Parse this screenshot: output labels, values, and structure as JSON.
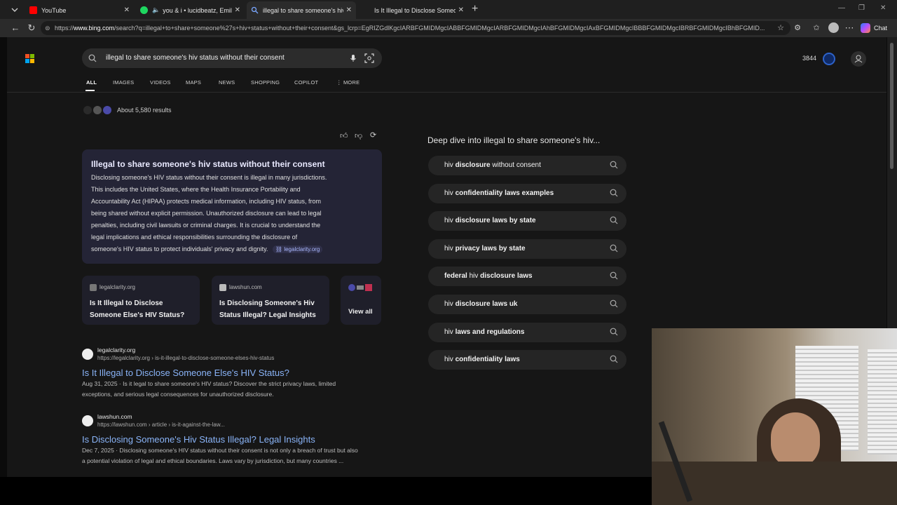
{
  "tabs": [
    {
      "title": "YouTube",
      "active": false
    },
    {
      "title": "you & i • lucidbeatz, Emilia Ali",
      "active": false
    },
    {
      "title": "illegal to share someone's hiv stat",
      "active": true
    },
    {
      "title": "Is It Illegal to Disclose Someone E",
      "active": false
    }
  ],
  "new_tab_label": "+",
  "url": {
    "prefix": "https://",
    "host": "www.bing.com",
    "rest": "/search?q=illegal+to+share+someone%27s+hiv+status+without+their+consent&gs_lcrp=EgRIZGdlKgcIARBFGMIDMgcIABBFGMIDMgcIARBFGMIDMgcIAhBFGMIDMgcIAxBFGMIDMgcIBBBFGMIDMgcIBRBFGMIDMgcIBhBFGMID..."
  },
  "copilot_chat_label": "Chat",
  "search": {
    "query": "illegal to share someone's hiv status without their consent"
  },
  "rewards_points": "3844",
  "scopes": [
    "ALL",
    "IMAGES",
    "VIDEOS",
    "MAPS",
    "NEWS",
    "SHOPPING",
    "COPILOT",
    "MORE"
  ],
  "results_count": "About 5,580 results",
  "answer": {
    "title": "Illegal to share someone's hiv status without their consent",
    "lines": [
      "Disclosing someone's HIV status without their consent is illegal in many jurisdictions.",
      "This includes the United States, where the Health Insurance Portability and",
      "Accountability Act (HIPAA) protects medical information, including HIV status, from",
      "being shared without explicit permission. Unauthorized disclosure can lead to legal",
      "penalties, including civil lawsuits or criminal charges. It is crucial to understand the",
      "legal implications and ethical responsibilities surrounding the disclosure of",
      "someone's HIV status to protect individuals' privacy and dignity."
    ],
    "source": "legalclarity.org"
  },
  "source_cards": [
    {
      "domain": "legalclarity.org",
      "title_l1": "Is It Illegal to Disclose",
      "title_l2": "Someone Else's HIV Status?"
    },
    {
      "domain": "lawshun.com",
      "title_l1": "Is Disclosing Someone's Hiv",
      "title_l2": "Status Illegal? Legal Insights"
    }
  ],
  "view_all_label": "View all",
  "results": [
    {
      "site": "legalclarity.org",
      "url": "https://legalclarity.org › is-it-illegal-to-disclose-someone-elses-hiv-status",
      "title": "Is It Illegal to Disclose Someone Else's HIV Status?",
      "snippet_l1": "Aug 31, 2025 · Is it legal to share someone's HIV status? Discover the strict privacy laws, limited",
      "snippet_l2": "exceptions, and serious legal consequences for unauthorized disclosure."
    },
    {
      "site": "lawshun.com",
      "url": "https://lawshun.com › article › is-it-against-the-law...",
      "title": "Is Disclosing Someone's Hiv Status Illegal? Legal Insights",
      "snippet_l1": "Dec 7, 2025 · Disclosing someone's HIV status without their consent is not only a breach of trust but also",
      "snippet_l2": "a potential violation of legal and ethical boundaries. Laws vary by jurisdiction, but many countries ..."
    }
  ],
  "deep_dive": {
    "heading": "Deep dive into illegal to share someone's hiv...",
    "items": [
      {
        "pre": "hiv ",
        "bold": "disclosure",
        "post": " without consent"
      },
      {
        "pre": "hiv ",
        "bold": "confidentiality laws examples",
        "post": ""
      },
      {
        "pre": "hiv ",
        "bold": "disclosure laws by state",
        "post": ""
      },
      {
        "pre": "hiv ",
        "bold": "privacy laws by state",
        "post": ""
      },
      {
        "pre": "",
        "bold": "federal",
        "post": " hiv ",
        "bold2": "disclosure laws"
      },
      {
        "pre": "hiv ",
        "bold": "disclosure laws uk",
        "post": ""
      },
      {
        "pre": "hiv ",
        "bold": "laws and regulations",
        "post": ""
      },
      {
        "pre": "hiv ",
        "bold": "confidentiality laws",
        "post": ""
      }
    ]
  },
  "colors": {
    "link": "#8ab4f8",
    "answer_bg": "#242436",
    "page_bg": "#161616"
  }
}
